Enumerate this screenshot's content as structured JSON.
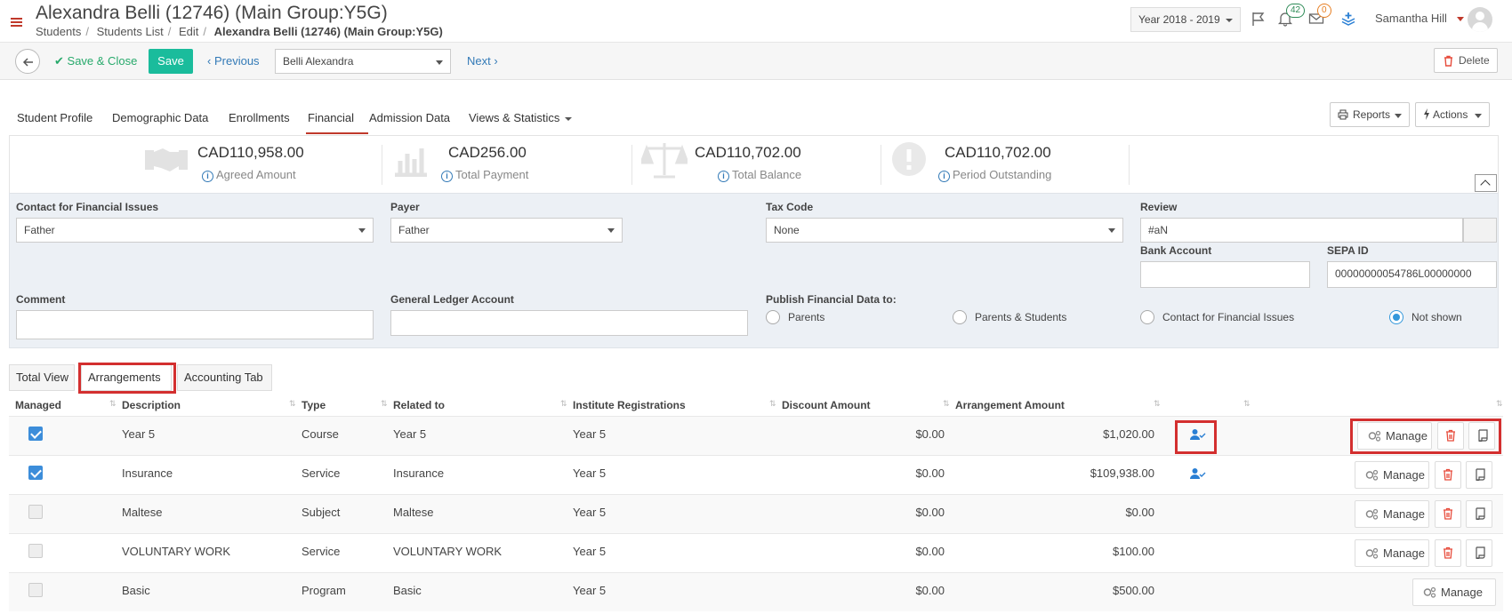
{
  "header": {
    "title": "Alexandra Belli (12746) (Main Group:Y5G)",
    "breadcrumb": [
      "Students",
      "Students List",
      "Edit",
      "Alexandra Belli (12746) (Main Group:Y5G)"
    ],
    "year_select": "Year 2018 - 2019",
    "notifications_count": "42",
    "messages_count": "0",
    "user_name": "Samantha Hill",
    "colors": {
      "accent_red": "#c0392b",
      "save_green": "#1abc9c",
      "link_blue": "#337ab7"
    }
  },
  "toolbar": {
    "save_close_label": "Save & Close",
    "save_label": "Save",
    "previous_label": "Previous",
    "student_select": "Belli Alexandra",
    "next_label": "Next",
    "delete_label": "Delete"
  },
  "tabs": {
    "items": [
      "Student Profile",
      "Demographic Data",
      "Enrollments",
      "Financial",
      "Admission Data",
      "Views & Statistics"
    ],
    "active": "Financial",
    "reports_label": "Reports",
    "actions_label": "Actions"
  },
  "stats": [
    {
      "amount": "CAD110,958.00",
      "label": "Agreed Amount",
      "icon": "handshake-icon"
    },
    {
      "amount": "CAD256.00",
      "label": "Total Payment",
      "icon": "bar-chart-icon"
    },
    {
      "amount": "CAD110,702.00",
      "label": "Total Balance",
      "icon": "balance-scale-icon"
    },
    {
      "amount": "CAD110,702.00",
      "label": "Period Outstanding",
      "icon": "exclamation-icon"
    }
  ],
  "form": {
    "contact_label": "Contact for Financial Issues",
    "contact_value": "Father",
    "payer_label": "Payer",
    "payer_value": "Father",
    "tax_label": "Tax Code",
    "tax_value": "None",
    "review_label": "Review",
    "review_value": "#aN",
    "bank_label": "Bank Account",
    "bank_value": "",
    "sepa_label": "SEPA ID",
    "sepa_value": "00000000054786L00000000",
    "comment_label": "Comment",
    "comment_value": "",
    "ledger_label": "General Ledger Account",
    "ledger_value": "",
    "publish_label": "Publish Financial Data to:",
    "publish_options": [
      "Parents",
      "Parents & Students",
      "Contact for Financial Issues",
      "Not shown"
    ],
    "publish_selected": "Not shown"
  },
  "subtabs": {
    "items": [
      "Total View",
      "Arrangements",
      "Accounting Tab"
    ],
    "active": "Arrangements"
  },
  "table": {
    "headers": [
      "Managed",
      "Description",
      "Type",
      "Related to",
      "Institute Registrations",
      "Discount Amount",
      "Arrangement Amount"
    ],
    "manage_label": "Manage",
    "rows": [
      {
        "managed": true,
        "description": "Year 5",
        "type": "Course",
        "related": "Year 5",
        "registrations": "Year 5",
        "discount": "$0.00",
        "amount": "$1,020.00",
        "user_icon": true
      },
      {
        "managed": true,
        "description": "Insurance",
        "type": "Service",
        "related": "Insurance",
        "registrations": "Year 5",
        "discount": "$0.00",
        "amount": "$109,938.00",
        "user_icon": true
      },
      {
        "managed": false,
        "description": "Maltese",
        "type": "Subject",
        "related": "Maltese",
        "registrations": "Year 5",
        "discount": "$0.00",
        "amount": "$0.00",
        "user_icon": false
      },
      {
        "managed": false,
        "description": "VOLUNTARY WORK",
        "type": "Service",
        "related": "VOLUNTARY WORK",
        "registrations": "Year 5",
        "discount": "$0.00",
        "amount": "$100.00",
        "user_icon": false
      },
      {
        "managed": false,
        "description": "Basic",
        "type": "Program",
        "related": "Basic",
        "registrations": "Year 5",
        "discount": "$0.00",
        "amount": "$500.00",
        "user_icon": false
      }
    ]
  }
}
